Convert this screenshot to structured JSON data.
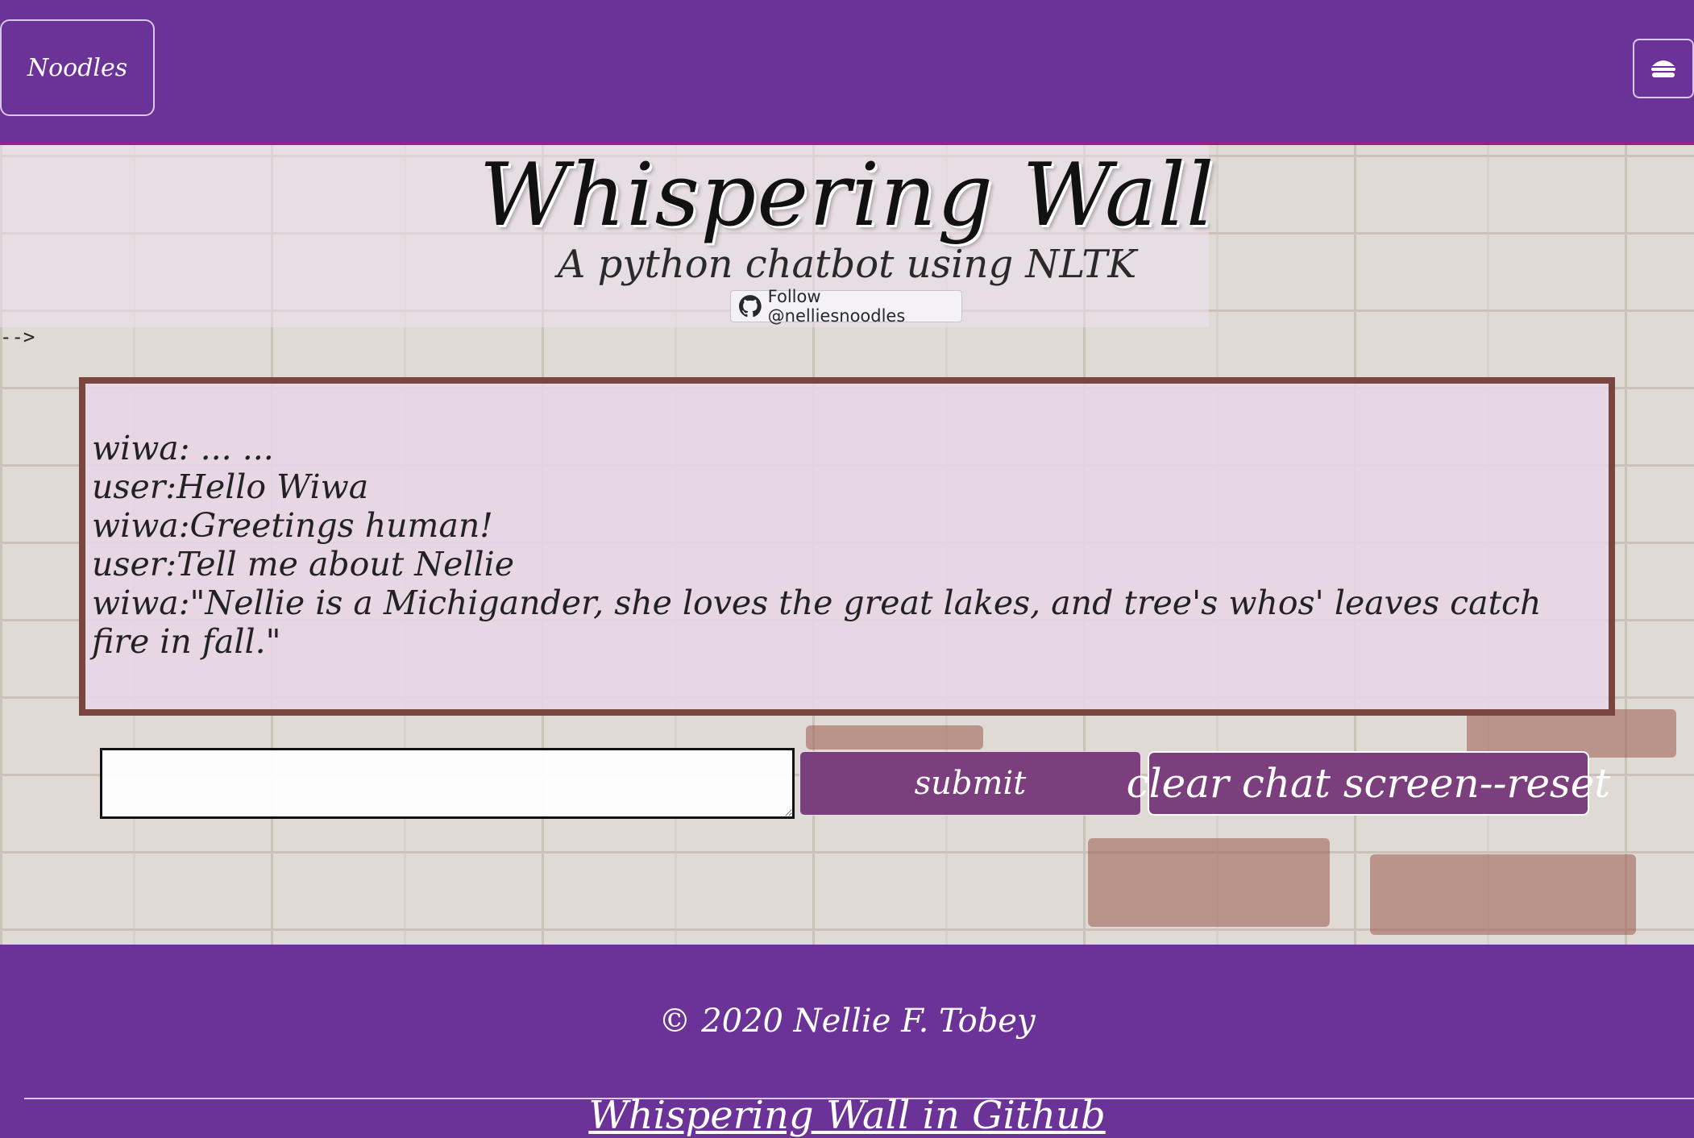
{
  "navbar": {
    "brand": "Noodles",
    "menu_icon": "hamburger-icon"
  },
  "header": {
    "title": "Whispering Wall",
    "subtitle": "A python chatbot using NLTK",
    "follow_label": "Follow @nelliesnoodles",
    "follow_icon": "github-icon",
    "stray_text": "-->"
  },
  "chat": {
    "lines": [
      "wiwa: ... ...",
      "user:Hello Wiwa",
      "wiwa:Greetings human!",
      "user:Tell me about Nellie",
      "wiwa:\"Nellie is a Michigander, she loves the great lakes, and tree's whos' leaves catch fire in fall.\""
    ]
  },
  "input": {
    "value": "",
    "submit_label": "submit",
    "reset_label": "clear chat screen--reset"
  },
  "footer": {
    "copyright": "© 2020 Nellie F. Tobey",
    "github_link": "Whispering Wall in Github"
  },
  "colors": {
    "brand_purple": "#6b3398",
    "button_purple": "#7b3f7d",
    "chat_border": "#7a4640"
  }
}
